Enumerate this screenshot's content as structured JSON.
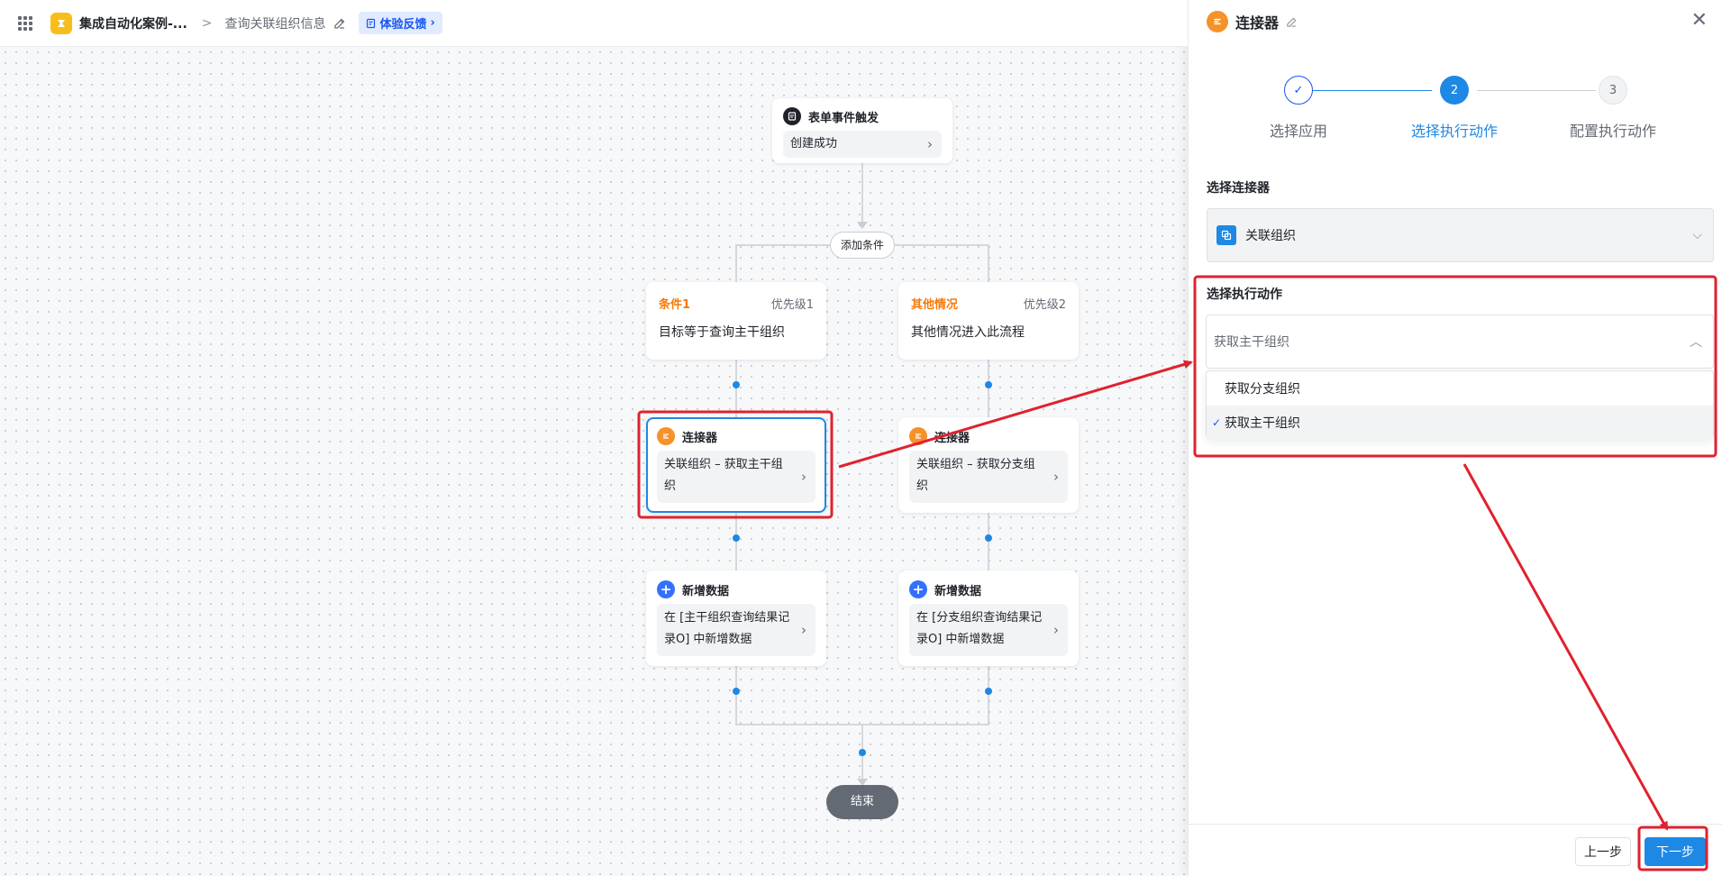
{
  "header": {
    "app_name": "集成自动化案例-...",
    "breadcrumb_sep": ">",
    "flow_name": "查询关联组织信息",
    "feedback_label": "体验反馈"
  },
  "canvas": {
    "trigger": {
      "title": "表单事件触发",
      "body": "创建成功"
    },
    "add_condition": "添加条件",
    "branches": [
      {
        "cond_name": "条件1",
        "priority": "优先级1",
        "cond_text": "目标等于查询主干组织",
        "connector_title": "连接器",
        "connector_body": "关联组织 – 获取主干组织",
        "add_title": "新增数据",
        "add_body": "在 [主干组织查询结果记录O] 中新增数据"
      },
      {
        "cond_name": "其他情况",
        "priority": "优先级2",
        "cond_text": "其他情况进入此流程",
        "connector_title": "连接器",
        "connector_body": "关联组织 – 获取分支组织",
        "add_title": "新增数据",
        "add_body": "在 [分支组织查询结果记录O] 中新增数据"
      }
    ],
    "end_label": "结束"
  },
  "panel": {
    "title": "连接器",
    "steps": [
      {
        "label": "选择应用",
        "num": "1",
        "state": "done"
      },
      {
        "label": "选择执行动作",
        "num": "2",
        "state": "active"
      },
      {
        "label": "配置执行动作",
        "num": "3",
        "state": "todo"
      }
    ],
    "connector_label": "选择连接器",
    "connector_value": "关联组织",
    "action_label": "选择执行动作",
    "action_value": "获取主干组织",
    "options": [
      {
        "label": "获取分支组织",
        "selected": false
      },
      {
        "label": "获取主干组织",
        "selected": true
      }
    ],
    "prev_label": "上一步",
    "next_label": "下一步"
  },
  "colors": {
    "primary": "#1e88e5",
    "condition": "#f57a0a",
    "annotation": "#e0212f",
    "connector_icon": "#f5922a",
    "add_icon": "#3370ff"
  }
}
